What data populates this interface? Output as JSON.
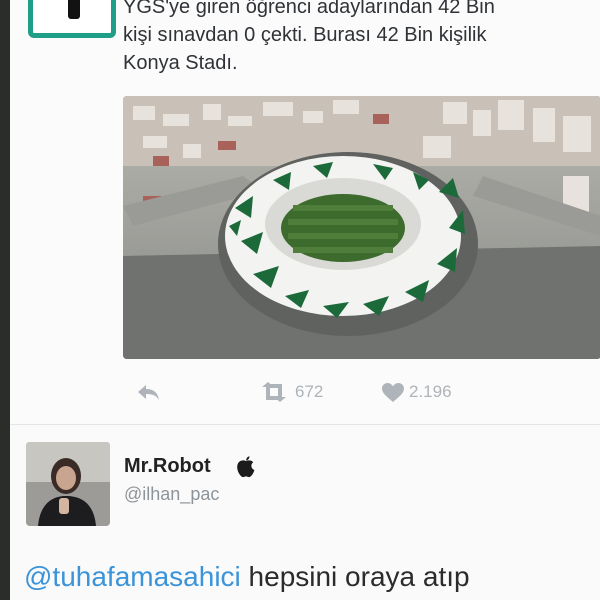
{
  "tweet_top": {
    "text_lines": [
      "YGS'ye giren öğrenci adaylarından 42 Bin",
      "kişi sınavdan 0 çekti. Burası 42 Bin kişilik",
      "Konya Stadı."
    ],
    "image": {
      "kind": "aerial-stadium-photo"
    },
    "actions": {
      "reply_icon": "reply-icon",
      "retweet_icon": "retweet-icon",
      "retweet_count": "672",
      "like_icon": "heart-icon",
      "like_count": "2.196"
    }
  },
  "tweet_bottom": {
    "display_name": "Mr.Robot",
    "badge_icon": "apple-icon",
    "username": "@ilhan_pac",
    "mention": "@tuhafamasahici",
    "text": " hepsini oraya atıp"
  },
  "colors": {
    "accent": "#1f9f8a",
    "mention": "#3b94d9",
    "muted": "#aeb4b9",
    "stadium_green": "#1c6a3a"
  }
}
